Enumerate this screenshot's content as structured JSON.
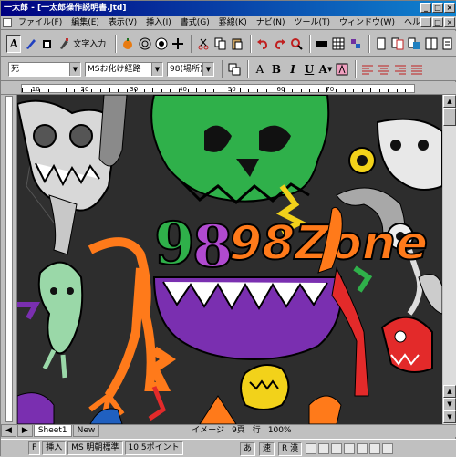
{
  "window": {
    "title": "一太郎 - [一太郎操作説明書.jtd]",
    "controls": [
      "_",
      "□",
      "×"
    ]
  },
  "menu": {
    "items": [
      {
        "label": "ファイル(F)"
      },
      {
        "label": "編集(E)"
      },
      {
        "label": "表示(V)"
      },
      {
        "label": "挿入(I)"
      },
      {
        "label": "書式(G)"
      },
      {
        "label": "罫線(K)"
      },
      {
        "label": "ナビ(N)"
      },
      {
        "label": "ツール(T)"
      },
      {
        "label": "ウィンドウ(W)"
      },
      {
        "label": "ヘルプ(H)"
      }
    ],
    "doc_controls": [
      "_",
      "□",
      "×"
    ]
  },
  "toolbar": {
    "text_input_label": "文字入力",
    "icons": [
      "text-mode-icon",
      "pen-icon",
      "fill-icon",
      "brush-icon",
      "pumpkin-icon",
      "circle-target-icon",
      "radio-icon",
      "crosshair-icon",
      "scissors-icon",
      "copy-icon",
      "paste-icon",
      "undo-icon",
      "redo-icon",
      "search-icon",
      "frame-icon",
      "table-icon",
      "sort-icon",
      "page-icon",
      "page-copy-icon",
      "page-view-icon",
      "page-split-icon",
      "zoom-page-icon"
    ]
  },
  "format_bar": {
    "style_value": "死",
    "font_value": "MSお化け経路",
    "size_value": "98(場所)",
    "bold": "B",
    "italic": "I",
    "underline": "U",
    "font_color_label": "A",
    "text_glyph": "A"
  },
  "ruler": {
    "numbers": [
      "10",
      "20",
      "30",
      "40",
      "50",
      "60",
      "70"
    ]
  },
  "document": {
    "title_text": "98Zone"
  },
  "bottom_bar": {
    "sheet_tab": "Sheet1",
    "new_tab": "New",
    "image_label": "イメージ",
    "page_label": "9頁",
    "line_label": "行",
    "zoom": "100%"
  },
  "status": {
    "mode": "F",
    "insert": "挿入",
    "font": "MS 明朝標準",
    "size": "10.5ポイント",
    "ime_labels": [
      "あ",
      "速",
      "R 漢"
    ]
  },
  "colors": {
    "title_start": "#000080",
    "title_end": "#1084d0",
    "green": "#2fb04a",
    "purple": "#7a2fb0",
    "orange": "#ff7a1a",
    "red": "#e32a2a"
  }
}
